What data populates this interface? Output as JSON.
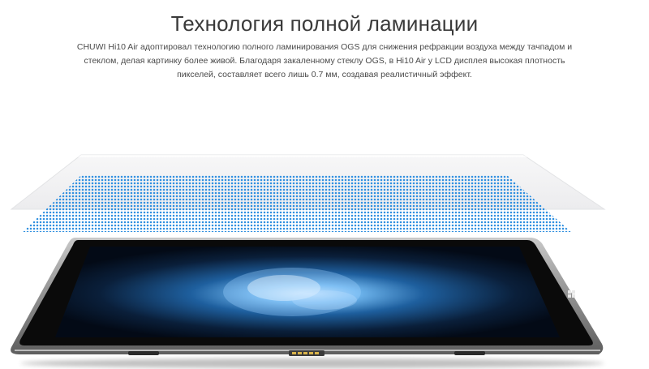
{
  "section": {
    "title": "Технология полной ламинации",
    "description": "CHUWI Hi10 Air адоптировал технологию полного ламинирования OGS для снижения рефракции воздуха между тачпадом и стеклом, делая картинку более живой. Благодаря закаленному стеклу OGS, в Hi10 Air у LCD дисплея высокая плотность пикселей, составляет всего лишь 0.7 мм, создавая реалистичный эффект."
  },
  "illustration": {
    "layers": [
      "glass-layer",
      "touch-grid-layer",
      "tablet-display"
    ],
    "colors": {
      "grid_dot": "#2f8fe0",
      "glass": "#f3f4f5",
      "bezel": "#0a0a0a",
      "frame": "#9a9a9a",
      "screen_glow": "#4aa3e8"
    }
  }
}
